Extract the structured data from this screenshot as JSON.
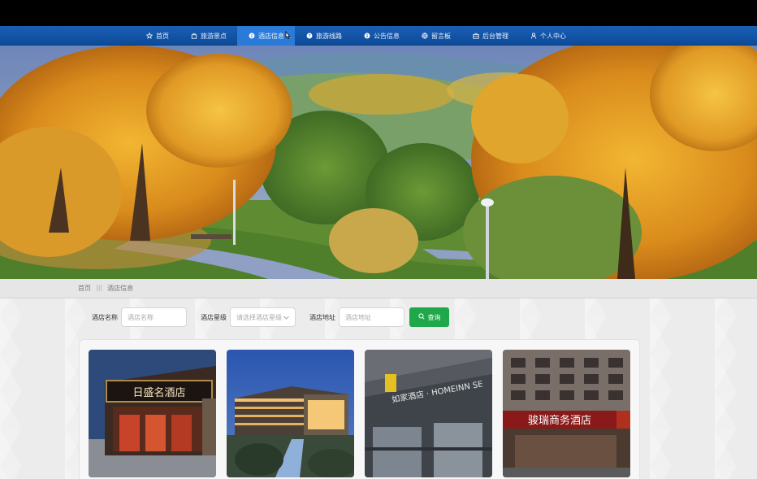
{
  "nav": {
    "items": [
      {
        "label": "首页",
        "icon": "star-icon"
      },
      {
        "label": "旅游景点",
        "icon": "bag-icon"
      },
      {
        "label": "酒店信息",
        "icon": "info-icon",
        "active": true
      },
      {
        "label": "旅游线路",
        "icon": "help-icon"
      },
      {
        "label": "公告信息",
        "icon": "info-icon"
      },
      {
        "label": "留言板",
        "icon": "globe-icon"
      },
      {
        "label": "后台管理",
        "icon": "briefcase-icon"
      },
      {
        "label": "个人中心",
        "icon": "user-icon"
      }
    ]
  },
  "carousel": {
    "slides": 3,
    "active_index": 0
  },
  "breadcrumb": {
    "home": "首页",
    "separator": "|||",
    "current": "酒店信息"
  },
  "search": {
    "name_label": "酒店名称",
    "name_placeholder": "酒店名称",
    "level_label": "酒店星级",
    "level_placeholder": "请选择酒店星级",
    "address_label": "酒店地址",
    "address_placeholder": "酒店地址",
    "submit_label": "查询"
  },
  "hotels": [
    {
      "sign": "日盛名酒店"
    },
    {
      "sign": ""
    },
    {
      "sign": "如家酒店 · HOMEINN SE"
    },
    {
      "sign": "骏瑞商务酒店"
    }
  ],
  "colors": {
    "nav_bg": "#1a5fb4",
    "nav_active": "#2a7ad8",
    "button_green": "#1fa84a"
  }
}
